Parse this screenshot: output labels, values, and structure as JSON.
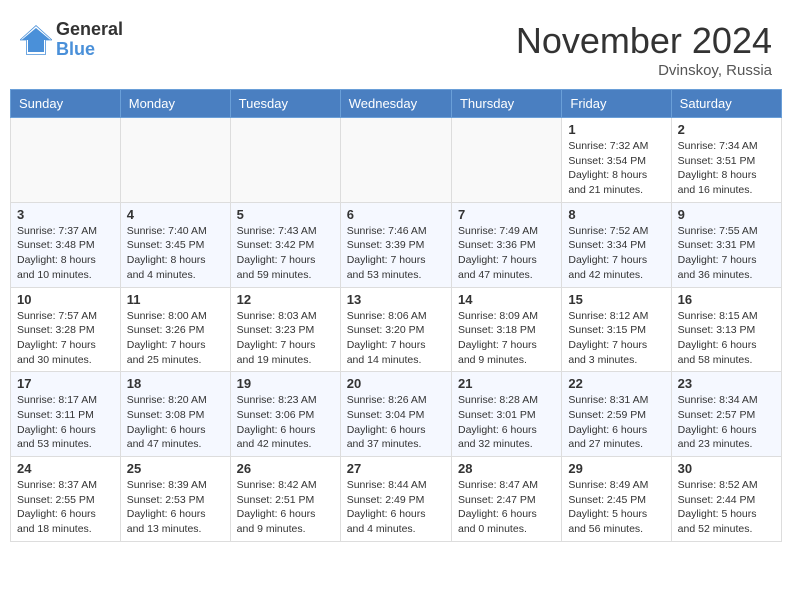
{
  "header": {
    "logo_general": "General",
    "logo_blue": "Blue",
    "month_title": "November 2024",
    "location": "Dvinskoy, Russia"
  },
  "weekdays": [
    "Sunday",
    "Monday",
    "Tuesday",
    "Wednesday",
    "Thursday",
    "Friday",
    "Saturday"
  ],
  "weeks": [
    [
      {
        "day": "",
        "info": ""
      },
      {
        "day": "",
        "info": ""
      },
      {
        "day": "",
        "info": ""
      },
      {
        "day": "",
        "info": ""
      },
      {
        "day": "",
        "info": ""
      },
      {
        "day": "1",
        "info": "Sunrise: 7:32 AM\nSunset: 3:54 PM\nDaylight: 8 hours\nand 21 minutes."
      },
      {
        "day": "2",
        "info": "Sunrise: 7:34 AM\nSunset: 3:51 PM\nDaylight: 8 hours\nand 16 minutes."
      }
    ],
    [
      {
        "day": "3",
        "info": "Sunrise: 7:37 AM\nSunset: 3:48 PM\nDaylight: 8 hours\nand 10 minutes."
      },
      {
        "day": "4",
        "info": "Sunrise: 7:40 AM\nSunset: 3:45 PM\nDaylight: 8 hours\nand 4 minutes."
      },
      {
        "day": "5",
        "info": "Sunrise: 7:43 AM\nSunset: 3:42 PM\nDaylight: 7 hours\nand 59 minutes."
      },
      {
        "day": "6",
        "info": "Sunrise: 7:46 AM\nSunset: 3:39 PM\nDaylight: 7 hours\nand 53 minutes."
      },
      {
        "day": "7",
        "info": "Sunrise: 7:49 AM\nSunset: 3:36 PM\nDaylight: 7 hours\nand 47 minutes."
      },
      {
        "day": "8",
        "info": "Sunrise: 7:52 AM\nSunset: 3:34 PM\nDaylight: 7 hours\nand 42 minutes."
      },
      {
        "day": "9",
        "info": "Sunrise: 7:55 AM\nSunset: 3:31 PM\nDaylight: 7 hours\nand 36 minutes."
      }
    ],
    [
      {
        "day": "10",
        "info": "Sunrise: 7:57 AM\nSunset: 3:28 PM\nDaylight: 7 hours\nand 30 minutes."
      },
      {
        "day": "11",
        "info": "Sunrise: 8:00 AM\nSunset: 3:26 PM\nDaylight: 7 hours\nand 25 minutes."
      },
      {
        "day": "12",
        "info": "Sunrise: 8:03 AM\nSunset: 3:23 PM\nDaylight: 7 hours\nand 19 minutes."
      },
      {
        "day": "13",
        "info": "Sunrise: 8:06 AM\nSunset: 3:20 PM\nDaylight: 7 hours\nand 14 minutes."
      },
      {
        "day": "14",
        "info": "Sunrise: 8:09 AM\nSunset: 3:18 PM\nDaylight: 7 hours\nand 9 minutes."
      },
      {
        "day": "15",
        "info": "Sunrise: 8:12 AM\nSunset: 3:15 PM\nDaylight: 7 hours\nand 3 minutes."
      },
      {
        "day": "16",
        "info": "Sunrise: 8:15 AM\nSunset: 3:13 PM\nDaylight: 6 hours\nand 58 minutes."
      }
    ],
    [
      {
        "day": "17",
        "info": "Sunrise: 8:17 AM\nSunset: 3:11 PM\nDaylight: 6 hours\nand 53 minutes."
      },
      {
        "day": "18",
        "info": "Sunrise: 8:20 AM\nSunset: 3:08 PM\nDaylight: 6 hours\nand 47 minutes."
      },
      {
        "day": "19",
        "info": "Sunrise: 8:23 AM\nSunset: 3:06 PM\nDaylight: 6 hours\nand 42 minutes."
      },
      {
        "day": "20",
        "info": "Sunrise: 8:26 AM\nSunset: 3:04 PM\nDaylight: 6 hours\nand 37 minutes."
      },
      {
        "day": "21",
        "info": "Sunrise: 8:28 AM\nSunset: 3:01 PM\nDaylight: 6 hours\nand 32 minutes."
      },
      {
        "day": "22",
        "info": "Sunrise: 8:31 AM\nSunset: 2:59 PM\nDaylight: 6 hours\nand 27 minutes."
      },
      {
        "day": "23",
        "info": "Sunrise: 8:34 AM\nSunset: 2:57 PM\nDaylight: 6 hours\nand 23 minutes."
      }
    ],
    [
      {
        "day": "24",
        "info": "Sunrise: 8:37 AM\nSunset: 2:55 PM\nDaylight: 6 hours\nand 18 minutes."
      },
      {
        "day": "25",
        "info": "Sunrise: 8:39 AM\nSunset: 2:53 PM\nDaylight: 6 hours\nand 13 minutes."
      },
      {
        "day": "26",
        "info": "Sunrise: 8:42 AM\nSunset: 2:51 PM\nDaylight: 6 hours\nand 9 minutes."
      },
      {
        "day": "27",
        "info": "Sunrise: 8:44 AM\nSunset: 2:49 PM\nDaylight: 6 hours\nand 4 minutes."
      },
      {
        "day": "28",
        "info": "Sunrise: 8:47 AM\nSunset: 2:47 PM\nDaylight: 6 hours\nand 0 minutes."
      },
      {
        "day": "29",
        "info": "Sunrise: 8:49 AM\nSunset: 2:45 PM\nDaylight: 5 hours\nand 56 minutes."
      },
      {
        "day": "30",
        "info": "Sunrise: 8:52 AM\nSunset: 2:44 PM\nDaylight: 5 hours\nand 52 minutes."
      }
    ]
  ]
}
